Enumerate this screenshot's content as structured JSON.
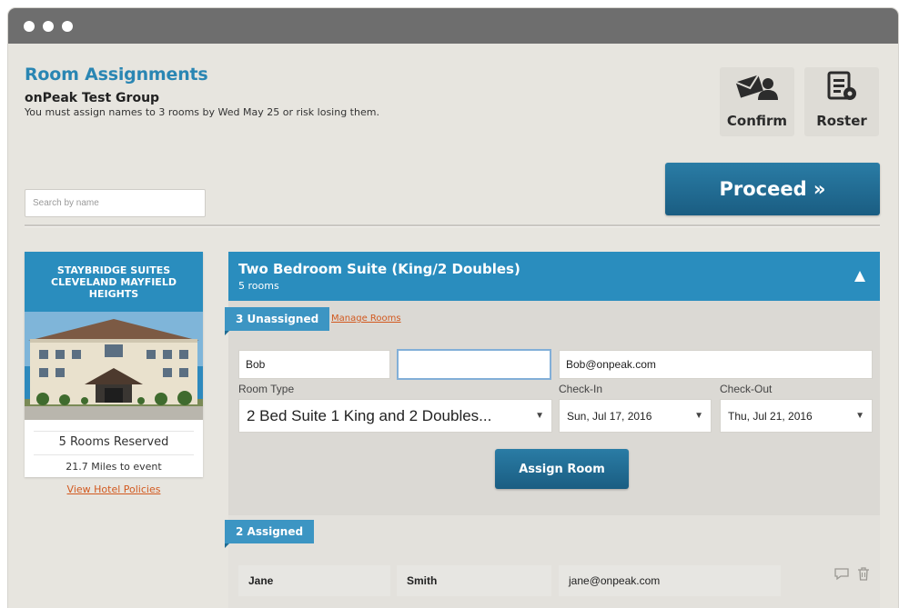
{
  "header": {
    "title": "Room Assignments",
    "group": "onPeak Test Group",
    "warning": "You must assign names to 3 rooms by Wed May 25 or risk losing them."
  },
  "toolbar": {
    "confirm_label": "Confirm",
    "roster_label": "Roster",
    "proceed_label": "Proceed »"
  },
  "search": {
    "placeholder": "Search by name"
  },
  "hotel": {
    "name": "STAYBRIDGE SUITES CLEVELAND MAYFIELD HEIGHTS",
    "rooms_reserved": "5 Rooms Reserved",
    "distance": "21.7 Miles to event",
    "policies_link": "View Hotel Policies"
  },
  "room_block": {
    "title": "Two Bedroom Suite (King/2 Doubles)",
    "count": "5 rooms",
    "unassigned_label": "3 Unassigned",
    "manage_link": "Manage Rooms",
    "form": {
      "first_name": "Bob",
      "last_name": "",
      "email": "Bob@onpeak.com",
      "room_type_label": "Room Type",
      "room_type_value": "2 Bed Suite 1 King and 2 Doubles...",
      "checkin_label": "Check-In",
      "checkin_value": "Sun, Jul 17, 2016",
      "checkout_label": "Check-Out",
      "checkout_value": "Thu, Jul 21, 2016",
      "assign_label": "Assign Room"
    },
    "assigned_label": "2 Assigned",
    "assigned_rows": [
      {
        "first": "Jane",
        "last": "Smith",
        "email": "jane@onpeak.com"
      }
    ]
  },
  "colors": {
    "accent_blue": "#2a8dbe",
    "button_blue": "#1f6b92",
    "link_orange": "#d2591f",
    "title_blue": "#2a86b3"
  },
  "icons": [
    "envelope-person-icon",
    "roster-gear-icon",
    "collapse-up-icon",
    "caret-down-icon",
    "comment-icon",
    "trash-icon"
  ]
}
